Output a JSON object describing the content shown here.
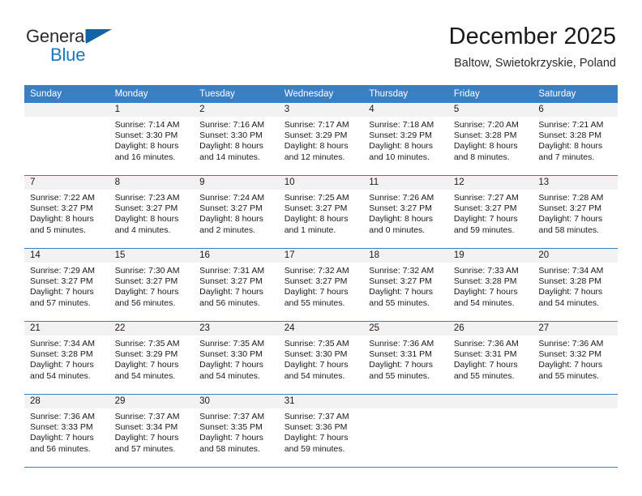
{
  "brand": {
    "name_part1": "General",
    "name_part2": "Blue",
    "accent_color": "#1878be"
  },
  "header": {
    "title": "December 2025",
    "location": "Baltow, Swietokrzyskie, Poland"
  },
  "theme": {
    "header_blue": "#3a7fc1",
    "daynum_gray": "#f2f2f2",
    "text": "#1a1a1a"
  },
  "labels": {
    "sunrise": "Sunrise:",
    "sunset": "Sunset:",
    "daylight": "Daylight:"
  },
  "weekdays": [
    "Sunday",
    "Monday",
    "Tuesday",
    "Wednesday",
    "Thursday",
    "Friday",
    "Saturday"
  ],
  "weeks": [
    [
      {
        "day": "",
        "sunrise": "",
        "sunset": "",
        "daylight_1": "",
        "daylight_2": ""
      },
      {
        "day": "1",
        "sunrise": "Sunrise: 7:14 AM",
        "sunset": "Sunset: 3:30 PM",
        "daylight_1": "Daylight: 8 hours",
        "daylight_2": "and 16 minutes."
      },
      {
        "day": "2",
        "sunrise": "Sunrise: 7:16 AM",
        "sunset": "Sunset: 3:30 PM",
        "daylight_1": "Daylight: 8 hours",
        "daylight_2": "and 14 minutes."
      },
      {
        "day": "3",
        "sunrise": "Sunrise: 7:17 AM",
        "sunset": "Sunset: 3:29 PM",
        "daylight_1": "Daylight: 8 hours",
        "daylight_2": "and 12 minutes."
      },
      {
        "day": "4",
        "sunrise": "Sunrise: 7:18 AM",
        "sunset": "Sunset: 3:29 PM",
        "daylight_1": "Daylight: 8 hours",
        "daylight_2": "and 10 minutes."
      },
      {
        "day": "5",
        "sunrise": "Sunrise: 7:20 AM",
        "sunset": "Sunset: 3:28 PM",
        "daylight_1": "Daylight: 8 hours",
        "daylight_2": "and 8 minutes."
      },
      {
        "day": "6",
        "sunrise": "Sunrise: 7:21 AM",
        "sunset": "Sunset: 3:28 PM",
        "daylight_1": "Daylight: 8 hours",
        "daylight_2": "and 7 minutes."
      }
    ],
    [
      {
        "day": "7",
        "sunrise": "Sunrise: 7:22 AM",
        "sunset": "Sunset: 3:27 PM",
        "daylight_1": "Daylight: 8 hours",
        "daylight_2": "and 5 minutes."
      },
      {
        "day": "8",
        "sunrise": "Sunrise: 7:23 AM",
        "sunset": "Sunset: 3:27 PM",
        "daylight_1": "Daylight: 8 hours",
        "daylight_2": "and 4 minutes."
      },
      {
        "day": "9",
        "sunrise": "Sunrise: 7:24 AM",
        "sunset": "Sunset: 3:27 PM",
        "daylight_1": "Daylight: 8 hours",
        "daylight_2": "and 2 minutes."
      },
      {
        "day": "10",
        "sunrise": "Sunrise: 7:25 AM",
        "sunset": "Sunset: 3:27 PM",
        "daylight_1": "Daylight: 8 hours",
        "daylight_2": "and 1 minute."
      },
      {
        "day": "11",
        "sunrise": "Sunrise: 7:26 AM",
        "sunset": "Sunset: 3:27 PM",
        "daylight_1": "Daylight: 8 hours",
        "daylight_2": "and 0 minutes."
      },
      {
        "day": "12",
        "sunrise": "Sunrise: 7:27 AM",
        "sunset": "Sunset: 3:27 PM",
        "daylight_1": "Daylight: 7 hours",
        "daylight_2": "and 59 minutes."
      },
      {
        "day": "13",
        "sunrise": "Sunrise: 7:28 AM",
        "sunset": "Sunset: 3:27 PM",
        "daylight_1": "Daylight: 7 hours",
        "daylight_2": "and 58 minutes."
      }
    ],
    [
      {
        "day": "14",
        "sunrise": "Sunrise: 7:29 AM",
        "sunset": "Sunset: 3:27 PM",
        "daylight_1": "Daylight: 7 hours",
        "daylight_2": "and 57 minutes."
      },
      {
        "day": "15",
        "sunrise": "Sunrise: 7:30 AM",
        "sunset": "Sunset: 3:27 PM",
        "daylight_1": "Daylight: 7 hours",
        "daylight_2": "and 56 minutes."
      },
      {
        "day": "16",
        "sunrise": "Sunrise: 7:31 AM",
        "sunset": "Sunset: 3:27 PM",
        "daylight_1": "Daylight: 7 hours",
        "daylight_2": "and 56 minutes."
      },
      {
        "day": "17",
        "sunrise": "Sunrise: 7:32 AM",
        "sunset": "Sunset: 3:27 PM",
        "daylight_1": "Daylight: 7 hours",
        "daylight_2": "and 55 minutes."
      },
      {
        "day": "18",
        "sunrise": "Sunrise: 7:32 AM",
        "sunset": "Sunset: 3:27 PM",
        "daylight_1": "Daylight: 7 hours",
        "daylight_2": "and 55 minutes."
      },
      {
        "day": "19",
        "sunrise": "Sunrise: 7:33 AM",
        "sunset": "Sunset: 3:28 PM",
        "daylight_1": "Daylight: 7 hours",
        "daylight_2": "and 54 minutes."
      },
      {
        "day": "20",
        "sunrise": "Sunrise: 7:34 AM",
        "sunset": "Sunset: 3:28 PM",
        "daylight_1": "Daylight: 7 hours",
        "daylight_2": "and 54 minutes."
      }
    ],
    [
      {
        "day": "21",
        "sunrise": "Sunrise: 7:34 AM",
        "sunset": "Sunset: 3:28 PM",
        "daylight_1": "Daylight: 7 hours",
        "daylight_2": "and 54 minutes."
      },
      {
        "day": "22",
        "sunrise": "Sunrise: 7:35 AM",
        "sunset": "Sunset: 3:29 PM",
        "daylight_1": "Daylight: 7 hours",
        "daylight_2": "and 54 minutes."
      },
      {
        "day": "23",
        "sunrise": "Sunrise: 7:35 AM",
        "sunset": "Sunset: 3:30 PM",
        "daylight_1": "Daylight: 7 hours",
        "daylight_2": "and 54 minutes."
      },
      {
        "day": "24",
        "sunrise": "Sunrise: 7:35 AM",
        "sunset": "Sunset: 3:30 PM",
        "daylight_1": "Daylight: 7 hours",
        "daylight_2": "and 54 minutes."
      },
      {
        "day": "25",
        "sunrise": "Sunrise: 7:36 AM",
        "sunset": "Sunset: 3:31 PM",
        "daylight_1": "Daylight: 7 hours",
        "daylight_2": "and 55 minutes."
      },
      {
        "day": "26",
        "sunrise": "Sunrise: 7:36 AM",
        "sunset": "Sunset: 3:31 PM",
        "daylight_1": "Daylight: 7 hours",
        "daylight_2": "and 55 minutes."
      },
      {
        "day": "27",
        "sunrise": "Sunrise: 7:36 AM",
        "sunset": "Sunset: 3:32 PM",
        "daylight_1": "Daylight: 7 hours",
        "daylight_2": "and 55 minutes."
      }
    ],
    [
      {
        "day": "28",
        "sunrise": "Sunrise: 7:36 AM",
        "sunset": "Sunset: 3:33 PM",
        "daylight_1": "Daylight: 7 hours",
        "daylight_2": "and 56 minutes."
      },
      {
        "day": "29",
        "sunrise": "Sunrise: 7:37 AM",
        "sunset": "Sunset: 3:34 PM",
        "daylight_1": "Daylight: 7 hours",
        "daylight_2": "and 57 minutes."
      },
      {
        "day": "30",
        "sunrise": "Sunrise: 7:37 AM",
        "sunset": "Sunset: 3:35 PM",
        "daylight_1": "Daylight: 7 hours",
        "daylight_2": "and 58 minutes."
      },
      {
        "day": "31",
        "sunrise": "Sunrise: 7:37 AM",
        "sunset": "Sunset: 3:36 PM",
        "daylight_1": "Daylight: 7 hours",
        "daylight_2": "and 59 minutes."
      },
      {
        "day": "",
        "sunrise": "",
        "sunset": "",
        "daylight_1": "",
        "daylight_2": ""
      },
      {
        "day": "",
        "sunrise": "",
        "sunset": "",
        "daylight_1": "",
        "daylight_2": ""
      },
      {
        "day": "",
        "sunrise": "",
        "sunset": "",
        "daylight_1": "",
        "daylight_2": ""
      }
    ]
  ]
}
